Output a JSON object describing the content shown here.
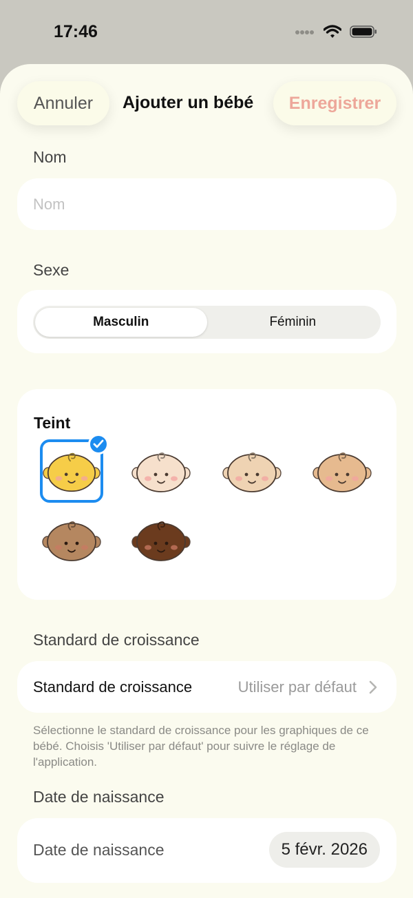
{
  "status": {
    "time": "17:46"
  },
  "nav": {
    "cancel": "Annuler",
    "title": "Ajouter un bébé",
    "save": "Enregistrer"
  },
  "name": {
    "label": "Nom",
    "placeholder": "Nom",
    "value": ""
  },
  "sex": {
    "label": "Sexe",
    "options": [
      "Masculin",
      "Féminin"
    ],
    "selected": "Masculin"
  },
  "teint": {
    "title": "Teint",
    "selected_index": 0,
    "skin_tones": [
      "#f6cd48",
      "#f6e0cc",
      "#efd3b3",
      "#e6ba8f",
      "#b58760",
      "#6b3b1e"
    ]
  },
  "growth": {
    "section_label": "Standard de croissance",
    "row_label": "Standard de croissance",
    "row_value": "Utiliser par défaut",
    "helper": "Sélectionne le standard de croissance pour les graphiques de ce bébé. Choisis 'Utiliser par défaut' pour suivre le réglage de l'application."
  },
  "birth": {
    "section_label": "Date de naissance",
    "row_label": "Date de naissance",
    "value": "5 févr. 2026"
  },
  "colors": {
    "sheet_bg": "#fbfbef",
    "accent": "#1c8cf0",
    "save_text": "#eda79a"
  }
}
